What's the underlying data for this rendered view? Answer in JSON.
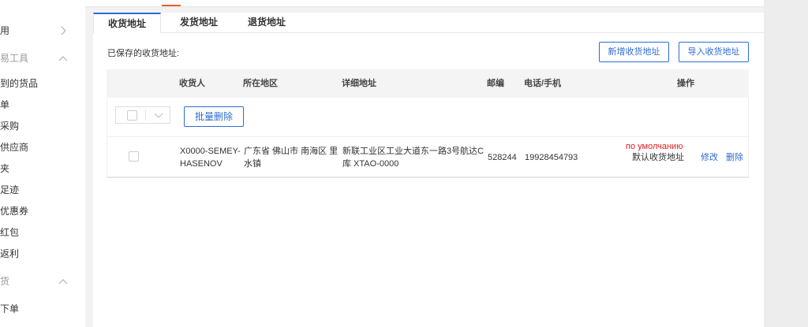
{
  "sidebar": {
    "items": [
      {
        "label": "用"
      },
      {
        "label": "易工具"
      },
      {
        "label": "到的货品"
      },
      {
        "label": "单"
      },
      {
        "label": "采购"
      },
      {
        "label": "供应商"
      },
      {
        "label": "夹"
      },
      {
        "label": "足迹"
      },
      {
        "label": "优惠券"
      },
      {
        "label": "红包"
      },
      {
        "label": "返利"
      },
      {
        "label": "货"
      },
      {
        "label": "下单"
      }
    ]
  },
  "tabs": [
    {
      "label": "收货地址",
      "active": true
    },
    {
      "label": "发货地址",
      "active": false
    },
    {
      "label": "退货地址",
      "active": false
    }
  ],
  "saved_label": "已保存的收货地址:",
  "buttons": {
    "add_address": "新增收货地址",
    "import_address": "导入收货地址",
    "bulk_delete": "批量删除"
  },
  "table": {
    "columns": {
      "receiver": "收货人",
      "region": "所在地区",
      "detail": "详细地址",
      "zip": "邮编",
      "phone": "电话/手机",
      "actions": "操作"
    },
    "rows": [
      {
        "receiver_line1": "X0000-SEMEY-",
        "receiver_line2": "HASENOV",
        "region_line1": "广东省 佛山市 南海区 里",
        "region_line2": "水镇",
        "detail_line1": "新联工业区工业大道东一路3号航达C",
        "detail_line2": "库 XTAO-0000",
        "zip": "528244",
        "phone": "19928454793",
        "default_ru": "по умолчанию",
        "default_zh": "默认收货地址",
        "edit": "修改",
        "delete": "删除"
      }
    ]
  },
  "colors": {
    "accent": "#2e6cd1",
    "danger": "#e02020",
    "top_marker": "#f25c2a"
  }
}
